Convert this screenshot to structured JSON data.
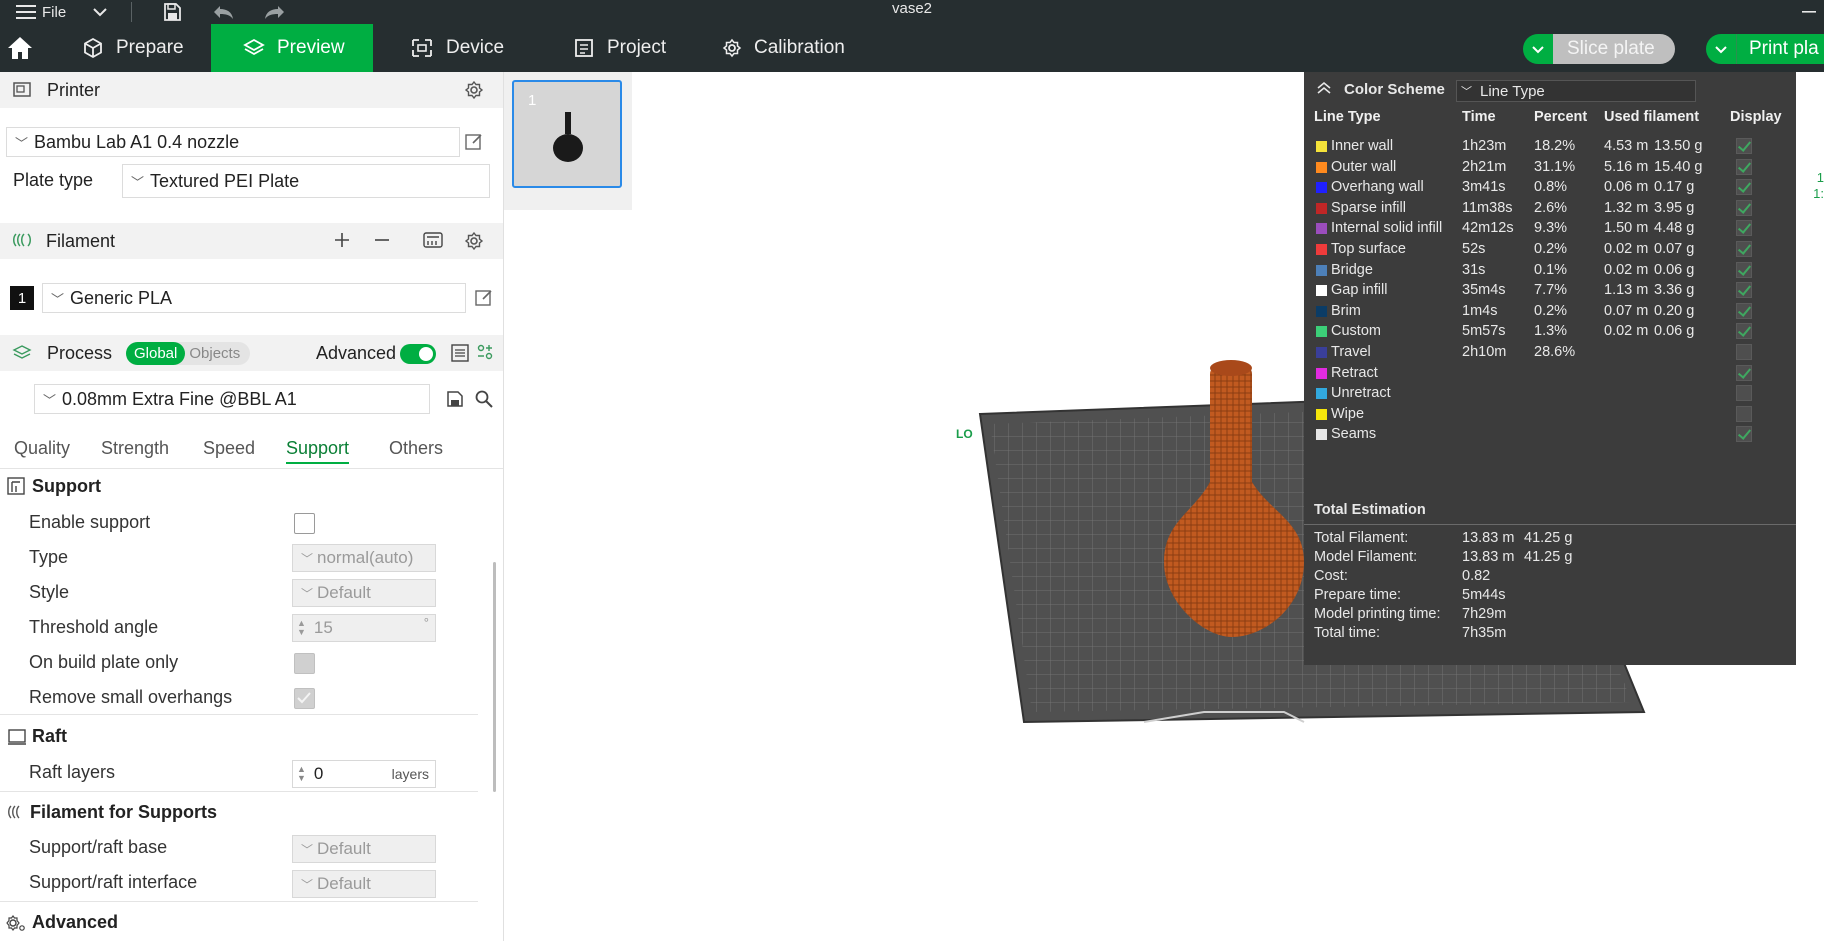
{
  "titlebar": {
    "menu_label": "File",
    "window_title": "vase2"
  },
  "nav": {
    "tabs": [
      {
        "label": "Prepare"
      },
      {
        "label": "Preview"
      },
      {
        "label": "Device"
      },
      {
        "label": "Project"
      },
      {
        "label": "Calibration"
      }
    ],
    "slice_label": "Slice plate",
    "print_label": "Print pla",
    "accent": "#00ae42"
  },
  "printer": {
    "title": "Printer",
    "name": "Bambu Lab A1 0.4 nozzle",
    "plate_type_label": "Plate type",
    "plate_type": "Textured PEI Plate"
  },
  "filament": {
    "title": "Filament",
    "slot_number": "1",
    "name": "Generic PLA"
  },
  "process": {
    "title": "Process",
    "toggle_global": "Global",
    "toggle_objects": "Objects",
    "advanced_label": "Advanced",
    "profile": "0.08mm Extra Fine @BBL A1",
    "tabs": [
      "Quality",
      "Strength",
      "Speed",
      "Support",
      "Others"
    ]
  },
  "support": {
    "group_title": "Support",
    "enable_label": "Enable support",
    "type_label": "Type",
    "type_value": "normal(auto)",
    "style_label": "Style",
    "style_value": "Default",
    "threshold_label": "Threshold angle",
    "threshold_value": "15",
    "threshold_unit": "°",
    "build_plate_label": "On build plate only",
    "remove_small_label": "Remove small overhangs"
  },
  "raft": {
    "group_title": "Raft",
    "layers_label": "Raft layers",
    "layers_value": "0",
    "layers_unit": "layers"
  },
  "filament_supports": {
    "group_title": "Filament for Supports",
    "base_label": "Support/raft base",
    "base_value": "Default",
    "interface_label": "Support/raft interface",
    "interface_value": "Default"
  },
  "advanced_group": {
    "title": "Advanced"
  },
  "plate": {
    "thumb_number": "1"
  },
  "legend": {
    "title": "Color Scheme",
    "scheme": "Line Type",
    "headers": [
      "Line Type",
      "Time",
      "Percent",
      "Used filament",
      "Display"
    ],
    "rows": [
      {
        "name": "Inner wall",
        "time": "1h23m",
        "percent": "18.2%",
        "len": "4.53 m",
        "weight": "13.50 g",
        "color": "#f5e33a",
        "display": true
      },
      {
        "name": "Outer wall",
        "time": "2h21m",
        "percent": "31.1%",
        "len": "5.16 m",
        "weight": "15.40 g",
        "color": "#ff8a1e",
        "display": true
      },
      {
        "name": "Overhang wall",
        "time": "3m41s",
        "percent": "0.8%",
        "len": "0.06 m",
        "weight": "0.17 g",
        "color": "#2020ff",
        "display": true
      },
      {
        "name": "Sparse infill",
        "time": "11m38s",
        "percent": "2.6%",
        "len": "1.32 m",
        "weight": "3.95 g",
        "color": "#c02626",
        "display": true
      },
      {
        "name": "Internal solid infill",
        "time": "42m12s",
        "percent": "9.3%",
        "len": "1.50 m",
        "weight": "4.48 g",
        "color": "#9b4dbd",
        "display": true
      },
      {
        "name": "Top surface",
        "time": "52s",
        "percent": "0.2%",
        "len": "0.02 m",
        "weight": "0.07 g",
        "color": "#ef3b3b",
        "display": true
      },
      {
        "name": "Bridge",
        "time": "31s",
        "percent": "0.1%",
        "len": "0.02 m",
        "weight": "0.06 g",
        "color": "#4d80b9",
        "display": true
      },
      {
        "name": "Gap infill",
        "time": "35m4s",
        "percent": "7.7%",
        "len": "1.13 m",
        "weight": "3.36 g",
        "color": "#ffffff",
        "display": true
      },
      {
        "name": "Brim",
        "time": "1m4s",
        "percent": "0.2%",
        "len": "0.07 m",
        "weight": "0.20 g",
        "color": "#0b3c66",
        "display": true
      },
      {
        "name": "Custom",
        "time": "5m57s",
        "percent": "1.3%",
        "len": "0.02 m",
        "weight": "0.06 g",
        "color": "#3ccf78",
        "display": true
      },
      {
        "name": "Travel",
        "time": "2h10m",
        "percent": "28.6%",
        "len": "",
        "weight": "",
        "color": "#3a3f9a",
        "display": false
      },
      {
        "name": "Retract",
        "time": "",
        "percent": "",
        "len": "",
        "weight": "",
        "color": "#e12be0",
        "display": true
      },
      {
        "name": "Unretract",
        "time": "",
        "percent": "",
        "len": "",
        "weight": "",
        "color": "#32a9de",
        "display": false
      },
      {
        "name": "Wipe",
        "time": "",
        "percent": "",
        "len": "",
        "weight": "",
        "color": "#f5e60c",
        "display": false
      },
      {
        "name": "Seams",
        "time": "",
        "percent": "",
        "len": "",
        "weight": "",
        "color": "#e6e6e6",
        "display": true
      }
    ],
    "total_title": "Total Estimation",
    "totals": [
      {
        "label": "Total Filament:",
        "v1": "13.83 m",
        "v2": "41.25 g"
      },
      {
        "label": "Model Filament:",
        "v1": "13.83 m",
        "v2": "41.25 g"
      },
      {
        "label": "Cost:",
        "v1": "0.82",
        "v2": ""
      },
      {
        "label": "Prepare time:",
        "v1": "5m44s",
        "v2": ""
      },
      {
        "label": "Model printing time:",
        "v1": "7h29m",
        "v2": ""
      },
      {
        "label": "Total time:",
        "v1": "7h35m",
        "v2": ""
      }
    ]
  },
  "bed_text": "LO",
  "right_edge_text": [
    "1",
    "1:"
  ]
}
